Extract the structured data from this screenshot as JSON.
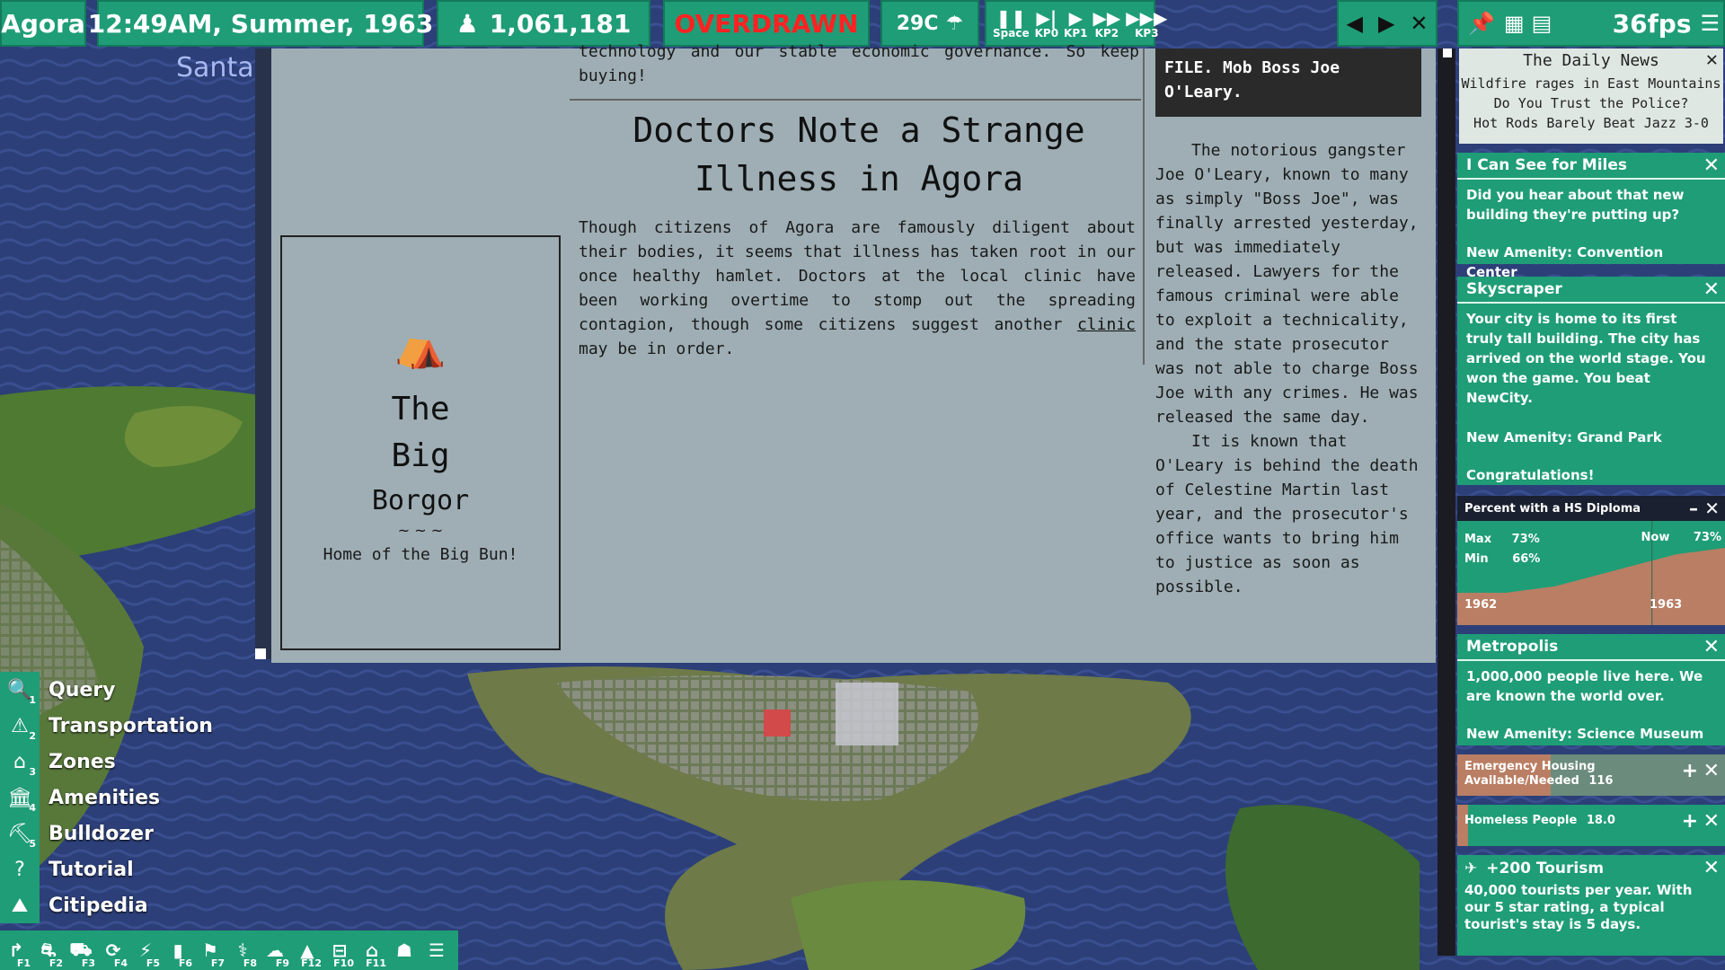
{
  "top_bar": {
    "city_name": "Agora",
    "datetime": "12:49AM,  Summer,  1963",
    "population": "1,061,181",
    "budget_status": "OVERDRAWN",
    "temperature": "29C",
    "speed_controls": [
      {
        "glyph": "❚❚",
        "key": "Space"
      },
      {
        "glyph": "▶|",
        "key": "KP0"
      },
      {
        "glyph": "▶",
        "key": "KP1"
      },
      {
        "glyph": "▶▶",
        "key": "KP2"
      },
      {
        "glyph": "▶▶▶",
        "key": "KP3"
      }
    ],
    "nav": {
      "prev": "◀",
      "next": "▶",
      "close": "✕"
    },
    "fps": "36fps"
  },
  "map_label": "Santa",
  "newspaper": {
    "top_snippet": "technology and our stable economic governance. So keep buying!",
    "headline_line1": "Doctors Note a Strange",
    "headline_line2": "Illness in Agora",
    "article_pre": "Though citizens of Agora are famously diligent about their bodies, it seems that illness has taken root in our once healthy hamlet. Doctors at the local clinic have been working overtime to stomp out the spreading contagion, though some citizens suggest another ",
    "article_link": "clinic",
    "article_post": " may be in order.",
    "ad": {
      "line1": "The",
      "line2": "Big",
      "line3": "Borgor",
      "flourish": "~ ~ ~",
      "tagline": "Home of the Big Bun!"
    },
    "photo_caption": "FILE. Mob Boss Joe O'Leary.",
    "side_para1": "The notorious gangster Joe O'Leary, known to many as simply \"Boss Joe\", was finally arrested yesterday, but was immediately released. Lawyers for the famous criminal were able to exploit a technicality, and the state prosecutor was not able to charge Boss Joe with any crimes. He was released the same day.",
    "side_para2": "It is known that O'Leary is behind the death of Celestine Martin last year, and the prosecutor's office wants to bring him to justice as soon as possible."
  },
  "tools_menu": [
    {
      "label": "Query",
      "num": "1",
      "icon": "magnifier-icon"
    },
    {
      "label": "Transportation",
      "num": "2",
      "icon": "road-icon"
    },
    {
      "label": "Zones",
      "num": "3",
      "icon": "house-icon"
    },
    {
      "label": "Amenities",
      "num": "4",
      "icon": "building-icon"
    },
    {
      "label": "Bulldozer",
      "num": "5",
      "icon": "bulldozer-icon"
    },
    {
      "label": "Tutorial",
      "num": "",
      "icon": "question-icon"
    },
    {
      "label": "Citipedia",
      "num": "",
      "icon": "book-icon"
    }
  ],
  "function_bar": [
    {
      "key": "F1",
      "glyph": "↱"
    },
    {
      "key": "F2",
      "glyph": "⛐"
    },
    {
      "key": "F3",
      "glyph": "⛟"
    },
    {
      "key": "F4",
      "glyph": "⟳"
    },
    {
      "key": "F5",
      "glyph": "⚡"
    },
    {
      "key": "F6",
      "glyph": "▮"
    },
    {
      "key": "F7",
      "glyph": "⚑"
    },
    {
      "key": "F8",
      "glyph": "⚕"
    },
    {
      "key": "F9",
      "glyph": "☁"
    },
    {
      "key": "F12",
      "glyph": "▲"
    },
    {
      "key": "F10",
      "glyph": "⊟"
    },
    {
      "key": "F11",
      "glyph": "⌂"
    },
    {
      "key": "",
      "glyph": "☗"
    },
    {
      "key": "",
      "glyph": "☰"
    }
  ],
  "daily_news": {
    "title": "The Daily News",
    "headlines": [
      "Wildfire rages in East Mountains",
      "Do You Trust the Police?",
      "Hot Rods Barely Beat Jazz 3-0"
    ]
  },
  "notifications": [
    {
      "title": "I Can See for Miles",
      "body": "Did you hear about that new building they're putting up?",
      "extra": "New Amenity: Convention Center"
    },
    {
      "title": "Skyscraper",
      "body": "Your city is home to its first truly tall building. The city has arrived on the world stage. You won the game. You beat NewCity.",
      "extra": "New Amenity: Grand Park",
      "extra2": "Congratulations!"
    },
    {
      "title": "Metropolis",
      "body": "1,000,000 people live here. We are known the world over.",
      "extra": "New Amenity: Science Museum"
    }
  ],
  "hs_chart": {
    "title": "Percent with a HS Diploma",
    "max_label": "Max",
    "max_value": "73%",
    "min_label": "Min",
    "min_value": "66%",
    "now_label": "Now",
    "now_value": "73%",
    "start_year": "1962",
    "end_year": "1963"
  },
  "chart_data": {
    "type": "area",
    "title": "Percent with a HS Diploma",
    "x": [
      "1962",
      "",
      "",
      "",
      "",
      "",
      "",
      "",
      "1963",
      "",
      "",
      ""
    ],
    "series": [
      {
        "values": [
          66,
          66,
          66,
          66.5,
          67,
          68,
          69,
          70,
          71,
          72,
          72.5,
          73
        ]
      }
    ],
    "ylim": [
      66,
      73
    ]
  },
  "emergency_housing": {
    "label": "Emergency Housing",
    "label2": "Available/Needed",
    "value": "116",
    "fill_fraction": 0.35
  },
  "homeless": {
    "label": "Homeless People",
    "value": "18.0"
  },
  "tourism": {
    "title": "+200 Tourism",
    "body": "40,000 tourists per year. With our 5 star rating, a typical tourist's stay is 5 days."
  },
  "colors": {
    "panel_green": "#1f9d76",
    "overdrawn_red": "#ff2222",
    "paper": "#9eaeb4",
    "ocean": "#2c3f78"
  }
}
